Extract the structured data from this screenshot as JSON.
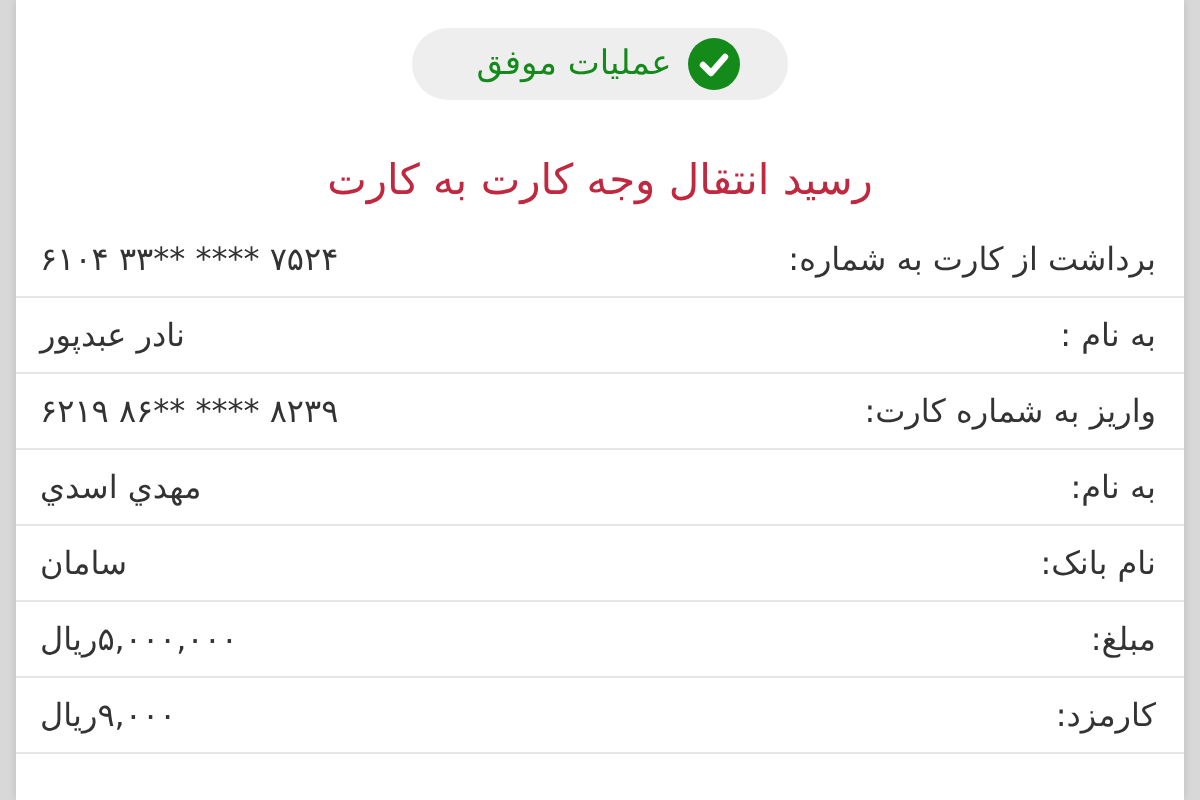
{
  "status": {
    "label": "عملیات موفق",
    "success": true
  },
  "title": "رسید انتقال وجه کارت به کارت",
  "rows": [
    {
      "label": "برداشت از کارت به شماره:",
      "value": "۶۱۰۴ ۳۳** **** ۷۵۲۴",
      "kind": "card"
    },
    {
      "label": "به نام :",
      "value": "نادر عبدپور",
      "kind": "text"
    },
    {
      "label": "واریز به شماره کارت:",
      "value": "۶۲۱۹ ۸۶** **** ۸۲۳۹",
      "kind": "card"
    },
    {
      "label": "به نام:",
      "value": "مهدي اسدي",
      "kind": "text"
    },
    {
      "label": "نام بانک:",
      "value": "سامان",
      "kind": "text"
    },
    {
      "label": "مبلغ:",
      "value": "۵,۰۰۰,۰۰۰ریال",
      "kind": "text"
    },
    {
      "label": "کارمزد:",
      "value": "۹,۰۰۰ریال",
      "kind": "text"
    }
  ]
}
